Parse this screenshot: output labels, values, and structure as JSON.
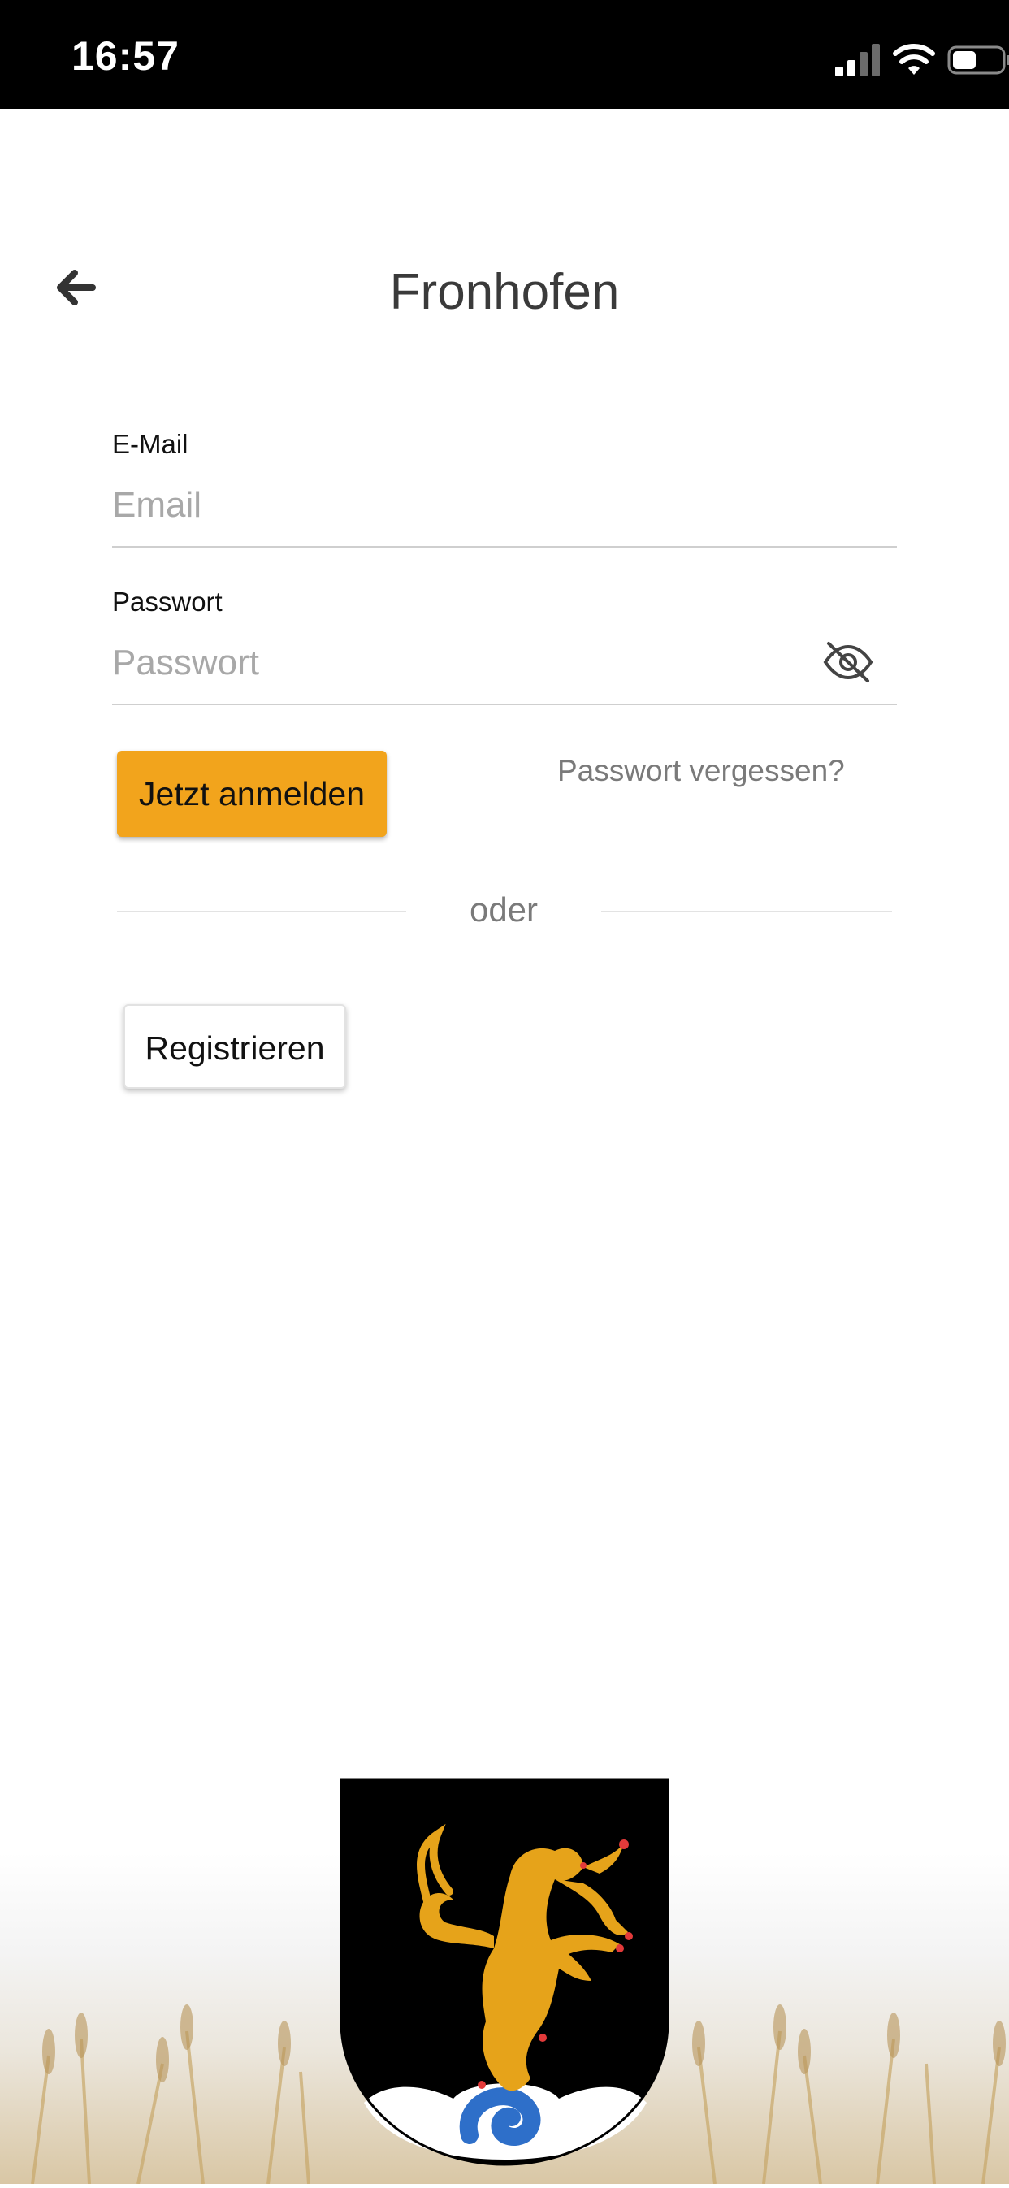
{
  "status_bar": {
    "time": "16:57",
    "signal_icon": "signal-icon",
    "wifi_icon": "wifi-icon",
    "battery_icon": "battery-icon"
  },
  "header": {
    "title": "Fronhofen",
    "back_icon": "arrow-left-icon"
  },
  "form": {
    "email_label": "E-Mail",
    "email_placeholder": "Email",
    "password_label": "Passwort",
    "password_placeholder": "Passwort",
    "toggle_visibility_icon": "eye-off-icon",
    "login_button": "Jetzt anmelden",
    "forgot_password": "Passwort vergessen?",
    "divider_text": "oder",
    "register_button": "Registrieren"
  },
  "branding": {
    "crest_icon": "coat-of-arms-icon"
  },
  "colors": {
    "accent": "#f2a41c",
    "text": "#3a3a3a",
    "muted": "#7a7a7a"
  }
}
